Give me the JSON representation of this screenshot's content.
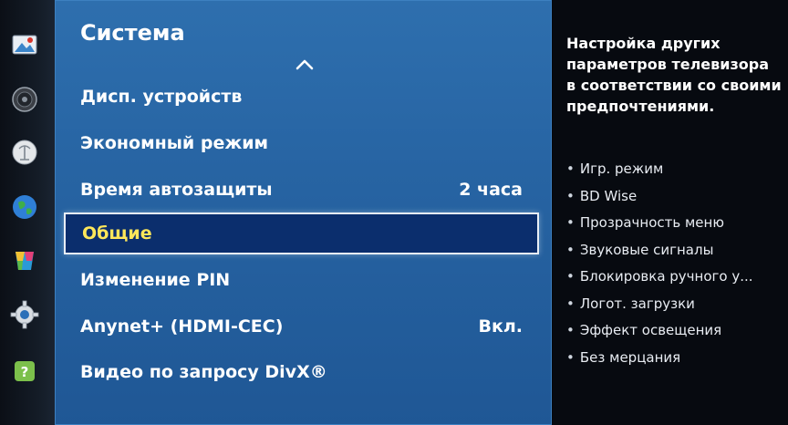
{
  "panel": {
    "title": "Система",
    "items": [
      {
        "label": "Дисп. устройств",
        "value": ""
      },
      {
        "label": "Экономный режим",
        "value": ""
      },
      {
        "label": "Время автозащиты",
        "value": "2 часа"
      },
      {
        "label": "Общие",
        "value": "",
        "selected": true
      },
      {
        "label": "Изменение PIN",
        "value": ""
      },
      {
        "label": "Anynet+ (HDMI-CEC)",
        "value": "Вкл."
      },
      {
        "label": "Видео по запросу DivX®",
        "value": ""
      }
    ]
  },
  "info": {
    "description": "Настройка других параметров телевизора в соответствии со своими предпочтениями.",
    "bullet": "•",
    "items": [
      "Игр. режим",
      "BD Wise",
      "Прозрачность меню",
      "Звуковые сигналы",
      "Блокировка ручного у...",
      "Логот. загрузки",
      "Эффект освещения",
      "Без мерцания"
    ]
  },
  "rail_icons": [
    "picture-icon",
    "sound-icon",
    "broadcast-icon",
    "network-icon",
    "smart-hub-icon",
    "system-gear-icon",
    "support-icon"
  ],
  "colors": {
    "panel_blue": "#2764a3",
    "selected_bg": "#0b2e6d",
    "selected_text": "#ffe75a"
  }
}
